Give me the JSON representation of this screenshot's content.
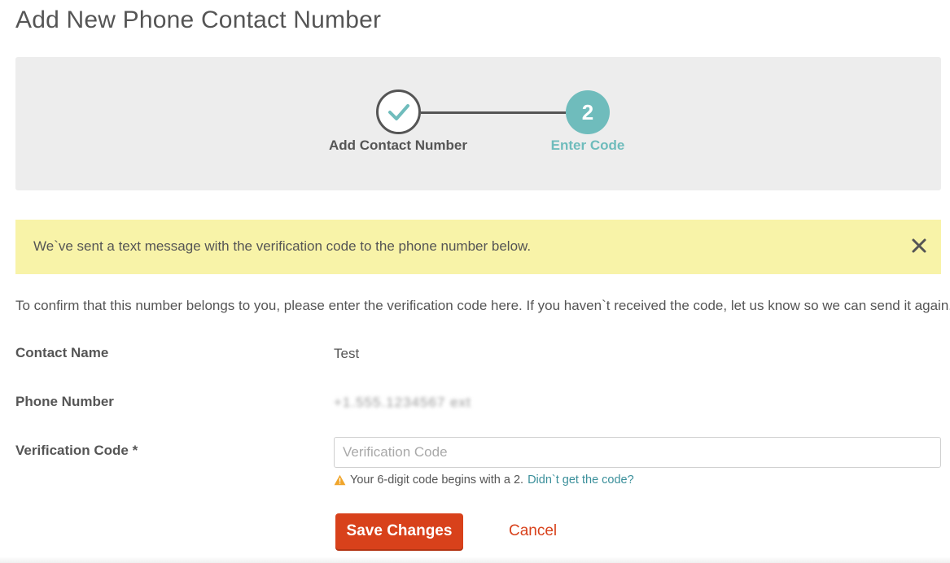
{
  "page": {
    "title": "Add New Phone Contact Number"
  },
  "stepper": {
    "steps": [
      {
        "label": "Add Contact Number",
        "state": "complete",
        "icon": "check-icon"
      },
      {
        "label": "Enter Code",
        "state": "active",
        "number": "2"
      }
    ],
    "colors": {
      "active": "#6fbcbc",
      "complete": "#555555"
    }
  },
  "alert": {
    "message": "We`ve sent a text message with the verification code to the phone number below.",
    "close_icon": "close-icon",
    "background": "#f8f3a8"
  },
  "intro_text": "To confirm that this number belongs to you, please enter the verification code here. If you haven`t received the code, let us know so we can send it again.",
  "form": {
    "contact_name": {
      "label": "Contact Name",
      "value": "Test"
    },
    "phone_number": {
      "label": "Phone Number",
      "value": "+1.555.1234567 ext"
    },
    "verification_code": {
      "label": "Verification Code *",
      "placeholder": "Verification Code",
      "value": "",
      "hint_text": "Your 6-digit code begins with a 2.",
      "hint_link": "Didn`t get the code?",
      "hint_icon": "warning-icon"
    }
  },
  "actions": {
    "save_label": "Save Changes",
    "cancel_label": "Cancel",
    "accent": "#d8411b"
  }
}
